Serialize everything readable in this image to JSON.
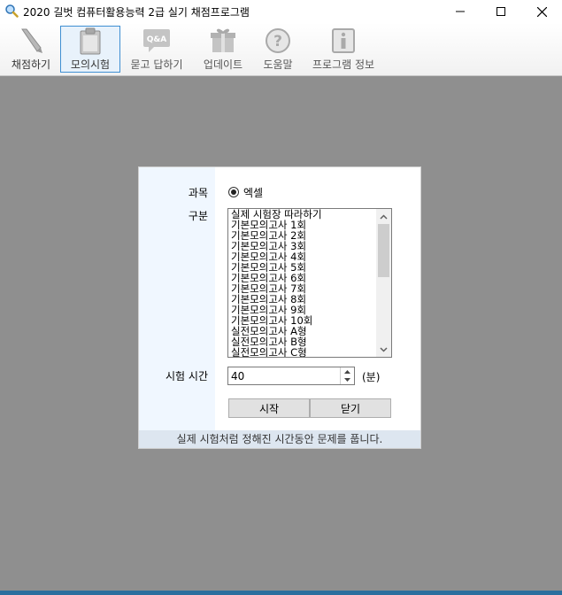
{
  "window": {
    "title": "2020 길벗 컴퓨터활용능력 2급 실기 채점프로그램"
  },
  "toolbar": {
    "items": [
      {
        "label": "채점하기",
        "icon": "pencil-icon"
      },
      {
        "label": "모의시험",
        "icon": "clipboard-icon"
      },
      {
        "label": "묻고 답하기",
        "icon": "qa-icon"
      },
      {
        "label": "업데이트",
        "icon": "gift-icon"
      },
      {
        "label": "도움말",
        "icon": "help-icon"
      },
      {
        "label": "프로그램 정보",
        "icon": "info-icon"
      }
    ],
    "qa_badge": "Q&A"
  },
  "dialog": {
    "subject_label": "과목",
    "subject_value": "엑셀",
    "category_label": "구분",
    "list_items": [
      "실제 시험장 따라하기",
      "기본모의고사 1회",
      "기본모의고사 2회",
      "기본모의고사 3회",
      "기본모의고사 4회",
      "기본모의고사 5회",
      "기본모의고사 6회",
      "기본모의고사 7회",
      "기본모의고사 8회",
      "기본모의고사 9회",
      "기본모의고사 10회",
      "실전모의고사 A형",
      "실전모의고사 B형",
      "실전모의고사 C형"
    ],
    "time_label": "시험 시간",
    "time_value": "40",
    "time_unit": "(분)",
    "start_button": "시작",
    "close_button": "닫기",
    "status": "실제 시험처럼 정해진 시간동안 문제를 풉니다."
  },
  "colors": {
    "workspace": "#8f8f8f",
    "dialog_left_panel": "#f0f7ff",
    "status_bar": "#dde6f0",
    "active_toolbar_border": "#3f8fd2"
  }
}
